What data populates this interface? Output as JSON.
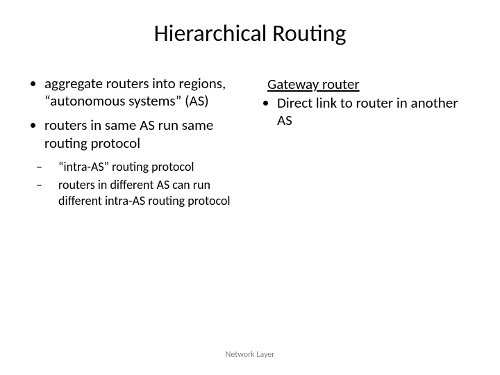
{
  "title": "Hierarchical Routing",
  "left": {
    "b1": "aggregate routers into regions, “autonomous systems” (AS)",
    "b2": "routers in same AS run same routing protocol",
    "s1": "“intra-AS” routing protocol",
    "s2": "routers in different AS can run different intra-AS routing protocol"
  },
  "right": {
    "heading": "Gateway router",
    "b1": "Direct link to router in another AS"
  },
  "footer": "Network Layer"
}
